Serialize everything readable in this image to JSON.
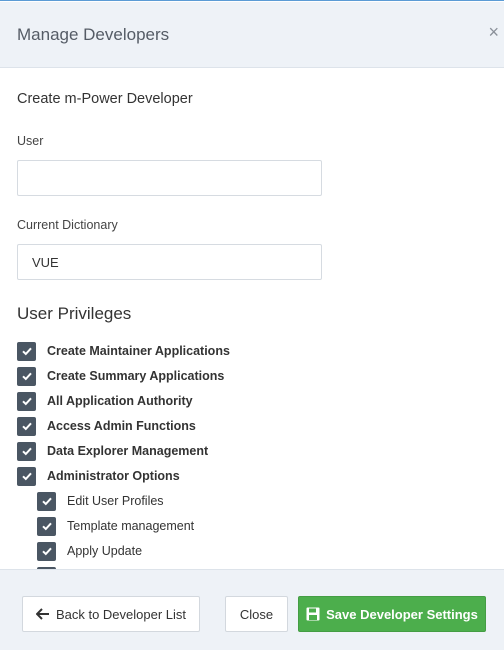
{
  "modal": {
    "title": "Manage Developers",
    "close_glyph": "×"
  },
  "form": {
    "heading": "Create m-Power Developer",
    "user_label": "User",
    "user_value": "",
    "dictionary_label": "Current Dictionary",
    "dictionary_value": "VUE"
  },
  "privileges": {
    "heading": "User Privileges",
    "items": [
      {
        "label": "Create Maintainer Applications",
        "checked": true,
        "bold": true
      },
      {
        "label": "Create Summary Applications",
        "checked": true,
        "bold": true
      },
      {
        "label": "All Application Authority",
        "checked": true,
        "bold": true
      },
      {
        "label": "Access Admin Functions",
        "checked": true,
        "bold": true
      },
      {
        "label": "Data Explorer Management",
        "checked": true,
        "bold": true
      },
      {
        "label": "Administrator Options",
        "checked": true,
        "bold": true
      }
    ],
    "sub_items": [
      {
        "label": "Edit User Profiles",
        "checked": true
      },
      {
        "label": "Template management",
        "checked": true
      },
      {
        "label": "Apply Update",
        "checked": true
      }
    ]
  },
  "footer": {
    "back_label": "Back to Developer List",
    "close_label": "Close",
    "save_label": "Save Developer Settings"
  },
  "colors": {
    "header_bg": "#eef2f7",
    "checkbox": "#4a5663",
    "save_button": "#4cae4c"
  },
  "icons": {
    "back": "arrow-left-icon",
    "save": "floppy-disk-icon",
    "check": "check-icon",
    "close": "close-icon"
  }
}
